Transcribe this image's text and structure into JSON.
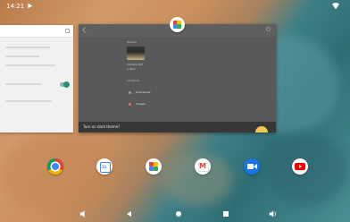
{
  "status_bar": {
    "time": "14:21",
    "notification_icon": "play-store-icon",
    "wifi_icon": "wifi-icon"
  },
  "recents": {
    "left_card": {
      "toggle_state": "on"
    },
    "main_card": {
      "app_icon": "google-photos-icon",
      "section_header": "Header",
      "caption_line1": "Camera Roll",
      "caption_line2": "1 item",
      "section_locations": "Locations",
      "rows": [
        {
          "label": "Downloads",
          "icon_color": "#9e9e9e"
        },
        {
          "label": "Images",
          "icon_color": "#e57373"
        }
      ],
      "snackbar_text": "Turn on dark theme?",
      "snackbar_icon": "sun-icon"
    }
  },
  "dock": {
    "apps": [
      {
        "name": "chrome",
        "icon": "chrome-icon"
      },
      {
        "name": "calendar",
        "icon": "calendar-icon",
        "date_text": "31"
      },
      {
        "name": "photos",
        "icon": "photos-icon"
      },
      {
        "name": "gmail",
        "icon": "gmail-icon"
      },
      {
        "name": "duo",
        "icon": "duo-video-icon"
      },
      {
        "name": "youtube",
        "icon": "youtube-icon"
      }
    ]
  },
  "navbar": {
    "buttons": [
      "volume-down",
      "back",
      "home",
      "recents",
      "volume-up"
    ]
  }
}
